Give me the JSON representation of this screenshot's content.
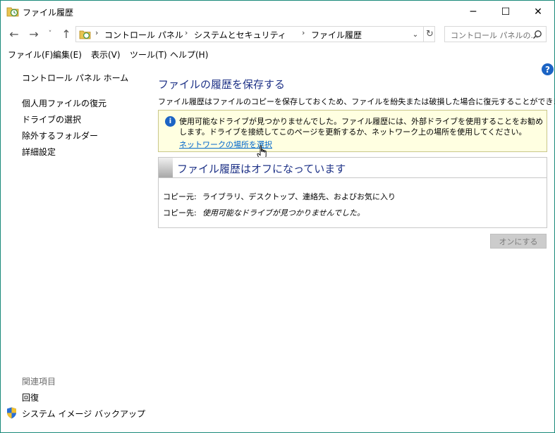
{
  "window": {
    "title": "ファイル履歴",
    "controls": {
      "minimize": "─",
      "maximize": "☐",
      "close": "✕"
    }
  },
  "nav": {
    "back": "←",
    "forward": "→",
    "recent": "˅",
    "up": "↑",
    "refresh": "↻",
    "dropdown": "⌄"
  },
  "address": {
    "separator": "›",
    "items": [
      "コントロール パネル",
      "システムとセキュリティ",
      "ファイル履歴"
    ]
  },
  "search": {
    "placeholder": "コントロール パネルの..."
  },
  "menu": {
    "items": [
      "ファイル(F)",
      "編集(E)",
      "表示(V)",
      "ツール(T)",
      "ヘルプ(H)"
    ]
  },
  "left": {
    "home": "コントロール パネル ホーム",
    "links": [
      "個人用ファイルの復元",
      "ドライブの選択",
      "除外するフォルダー",
      "詳細設定"
    ],
    "related_heading": "関連項目",
    "related": [
      "回復",
      "システム イメージ バックアップ"
    ]
  },
  "main": {
    "title": "ファイルの履歴を保存する",
    "description": "ファイル履歴はファイルのコピーを保存しておくため、ファイルを紛失または破損した場合に復元することができます。",
    "info": {
      "text": "使用可能なドライブが見つかりませんでした。ファイル履歴には、外部ドライブを使用することをお勧めします。ドライブを接続してこのページを更新するか、ネットワーク上の場所を使用してください。",
      "link": "ネットワークの場所を選択"
    },
    "status": {
      "title": "ファイル履歴はオフになっています",
      "copy_from_label": "コピー元:",
      "copy_from_value": "ライブラリ、デスクトップ、連絡先、およびお気に入り",
      "copy_to_label": "コピー先:",
      "copy_to_value": "使用可能なドライブが見つかりませんでした。"
    },
    "on_button": "オンにする"
  },
  "help": "?",
  "colors": {
    "title_blue": "#1e3287",
    "link_blue": "#0066cc",
    "info_bg": "#ffffe1",
    "border_teal": "#1a8a7a"
  }
}
